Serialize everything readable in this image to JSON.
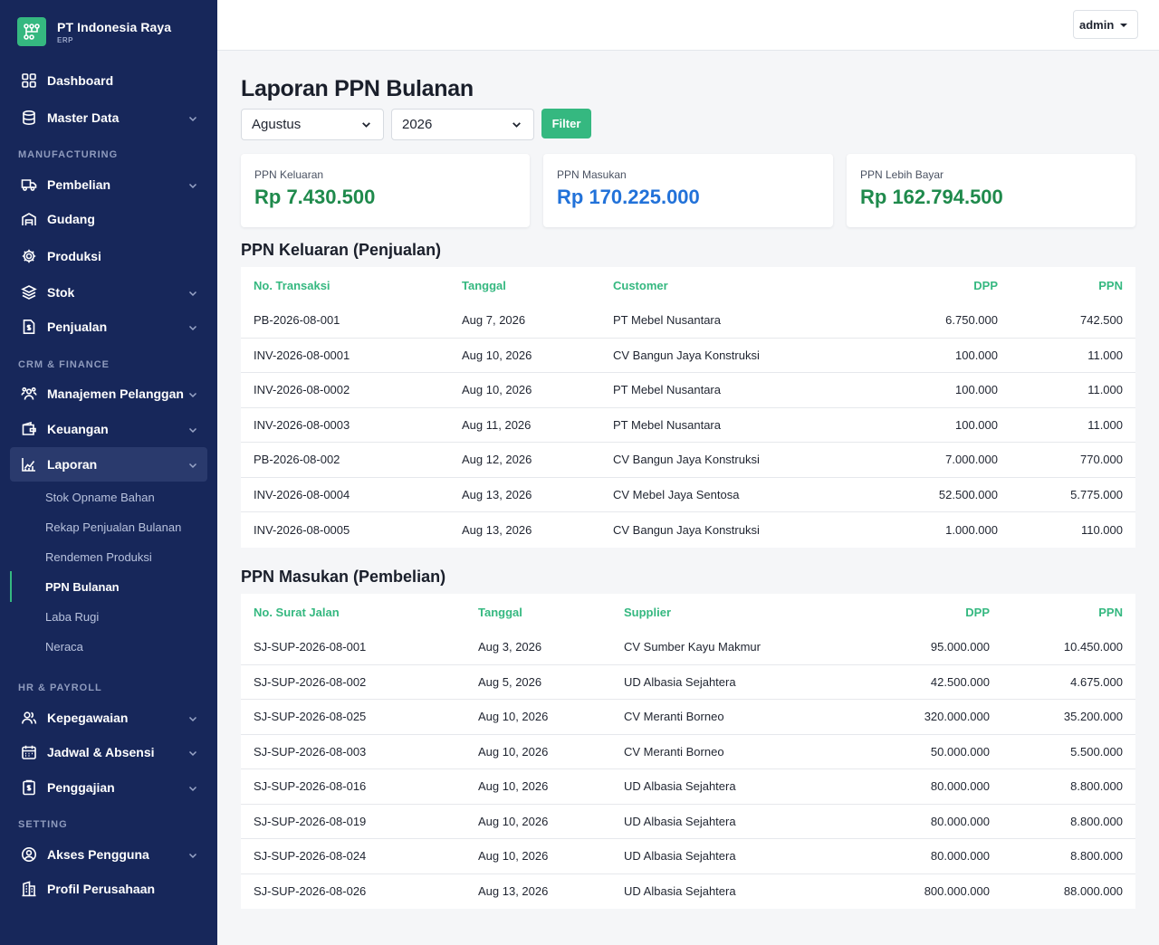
{
  "brand": {
    "name": "PT Indonesia Raya",
    "sub": "ERP"
  },
  "nav": {
    "dashboard": "Dashboard",
    "master_data": "Master Data",
    "sec_manufacturing": "MANUFACTURING",
    "pembelian": "Pembelian",
    "gudang": "Gudang",
    "produksi": "Produksi",
    "stok": "Stok",
    "penjualan": "Penjualan",
    "sec_crm": "CRM & FINANCE",
    "manajemen_pelanggan": "Manajemen Pelanggan",
    "keuangan": "Keuangan",
    "laporan": "Laporan",
    "laporan_sub": [
      "Stok Opname Bahan",
      "Rekap Penjualan Bulanan",
      "Rendemen Produksi",
      "PPN Bulanan",
      "Laba Rugi",
      "Neraca"
    ],
    "sec_hr": "HR & PAYROLL",
    "kepegawaian": "Kepegawaian",
    "jadwal": "Jadwal & Absensi",
    "penggajian": "Penggajian",
    "sec_setting": "SETTING",
    "akses": "Akses Pengguna",
    "profil": "Profil Perusahaan"
  },
  "topbar": {
    "user": "admin"
  },
  "page": {
    "title": "Laporan PPN Bulanan",
    "month": "Agustus",
    "year": "2026",
    "filter_label": "Filter"
  },
  "summary": {
    "keluaran_label": "PPN Keluaran",
    "keluaran_value": "Rp 7.430.500",
    "masukan_label": "PPN Masukan",
    "masukan_value": "Rp 170.225.000",
    "lebih_label": "PPN Lebih Bayar",
    "lebih_value": "Rp 162.794.500"
  },
  "colors": {
    "green": "#35b880",
    "value_green": "#1f8a4c",
    "value_blue": "#2272d9",
    "sidebar": "#17275a"
  },
  "keluaran": {
    "title": "PPN Keluaran (Penjualan)",
    "headers": {
      "no": "No. Transaksi",
      "tanggal": "Tanggal",
      "customer": "Customer",
      "dpp": "DPP",
      "ppn": "PPN"
    },
    "rows": [
      {
        "no": "PB-2026-08-001",
        "tanggal": "Aug 7, 2026",
        "customer": "PT Mebel Nusantara",
        "dpp": "6.750.000",
        "ppn": "742.500"
      },
      {
        "no": "INV-2026-08-0001",
        "tanggal": "Aug 10, 2026",
        "customer": "CV Bangun Jaya Konstruksi",
        "dpp": "100.000",
        "ppn": "11.000"
      },
      {
        "no": "INV-2026-08-0002",
        "tanggal": "Aug 10, 2026",
        "customer": "PT Mebel Nusantara",
        "dpp": "100.000",
        "ppn": "11.000"
      },
      {
        "no": "INV-2026-08-0003",
        "tanggal": "Aug 11, 2026",
        "customer": "PT Mebel Nusantara",
        "dpp": "100.000",
        "ppn": "11.000"
      },
      {
        "no": "PB-2026-08-002",
        "tanggal": "Aug 12, 2026",
        "customer": "CV Bangun Jaya Konstruksi",
        "dpp": "7.000.000",
        "ppn": "770.000"
      },
      {
        "no": "INV-2026-08-0004",
        "tanggal": "Aug 13, 2026",
        "customer": "CV Mebel Jaya Sentosa",
        "dpp": "52.500.000",
        "ppn": "5.775.000"
      },
      {
        "no": "INV-2026-08-0005",
        "tanggal": "Aug 13, 2026",
        "customer": "CV Bangun Jaya Konstruksi",
        "dpp": "1.000.000",
        "ppn": "110.000"
      }
    ]
  },
  "masukan": {
    "title": "PPN Masukan (Pembelian)",
    "headers": {
      "no": "No. Surat Jalan",
      "tanggal": "Tanggal",
      "supplier": "Supplier",
      "dpp": "DPP",
      "ppn": "PPN"
    },
    "rows": [
      {
        "no": "SJ-SUP-2026-08-001",
        "tanggal": "Aug 3, 2026",
        "supplier": "CV Sumber Kayu Makmur",
        "dpp": "95.000.000",
        "ppn": "10.450.000"
      },
      {
        "no": "SJ-SUP-2026-08-002",
        "tanggal": "Aug 5, 2026",
        "supplier": "UD Albasia Sejahtera",
        "dpp": "42.500.000",
        "ppn": "4.675.000"
      },
      {
        "no": "SJ-SUP-2026-08-025",
        "tanggal": "Aug 10, 2026",
        "supplier": "CV Meranti Borneo",
        "dpp": "320.000.000",
        "ppn": "35.200.000"
      },
      {
        "no": "SJ-SUP-2026-08-003",
        "tanggal": "Aug 10, 2026",
        "supplier": "CV Meranti Borneo",
        "dpp": "50.000.000",
        "ppn": "5.500.000"
      },
      {
        "no": "SJ-SUP-2026-08-016",
        "tanggal": "Aug 10, 2026",
        "supplier": "UD Albasia Sejahtera",
        "dpp": "80.000.000",
        "ppn": "8.800.000"
      },
      {
        "no": "SJ-SUP-2026-08-019",
        "tanggal": "Aug 10, 2026",
        "supplier": "UD Albasia Sejahtera",
        "dpp": "80.000.000",
        "ppn": "8.800.000"
      },
      {
        "no": "SJ-SUP-2026-08-024",
        "tanggal": "Aug 10, 2026",
        "supplier": "UD Albasia Sejahtera",
        "dpp": "80.000.000",
        "ppn": "8.800.000"
      },
      {
        "no": "SJ-SUP-2026-08-026",
        "tanggal": "Aug 13, 2026",
        "supplier": "UD Albasia Sejahtera",
        "dpp": "800.000.000",
        "ppn": "88.000.000"
      }
    ]
  }
}
